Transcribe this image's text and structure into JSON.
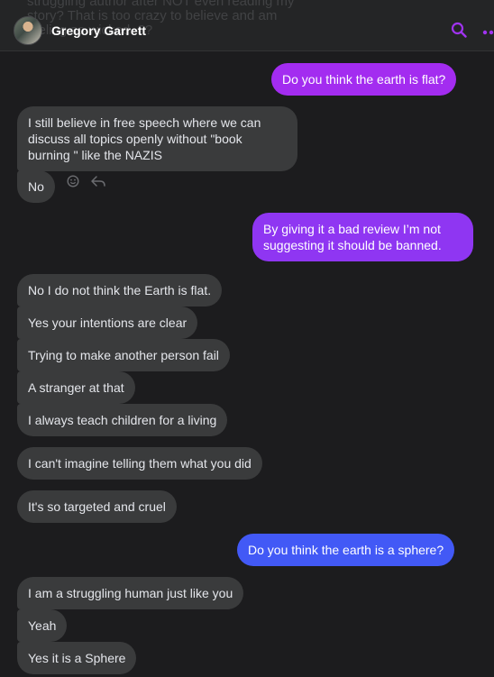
{
  "header": {
    "ghost_text": "struggling author after NOT even reading my story? That is too crazy to believe and am feeling so wicked. ??",
    "contact_name": "Gregory Garrett"
  },
  "colors": {
    "sent_gradient_top": "#a32cf0",
    "sent_gradient_bottom": "#3c5cf6",
    "received": "#3a3b3c",
    "accent_icons": "#a033f0"
  },
  "icons": [
    "search-icon",
    "more-icon",
    "emoji-react-icon",
    "reply-icon"
  ],
  "messages": [
    {
      "side": "out",
      "text": "Do you think the earth is flat?"
    },
    {
      "side": "in",
      "text": "I still believe in free speech where we can discuss all topics openly without \"book burning \" like the NAZIS"
    },
    {
      "side": "in",
      "text": "No"
    },
    {
      "side": "out",
      "text": "By giving it a bad review I’m not suggesting it should be banned."
    },
    {
      "side": "in",
      "text": "No I do not think the Earth is flat."
    },
    {
      "side": "in",
      "text": "Yes your intentions are clear"
    },
    {
      "side": "in",
      "text": "Trying to make another person fail"
    },
    {
      "side": "in",
      "text": "A stranger at that"
    },
    {
      "side": "in",
      "text": "I always teach children for a living"
    },
    {
      "side": "in",
      "text": "I can't imagine telling them what you did"
    },
    {
      "side": "in",
      "text": "It's so targeted and cruel"
    },
    {
      "side": "out",
      "text": "Do you think the earth is a sphere?"
    },
    {
      "side": "in",
      "text": "I am a struggling human just like you"
    },
    {
      "side": "in",
      "text": "Yeah"
    },
    {
      "side": "in",
      "text": "Yes it is a Sphere"
    }
  ]
}
